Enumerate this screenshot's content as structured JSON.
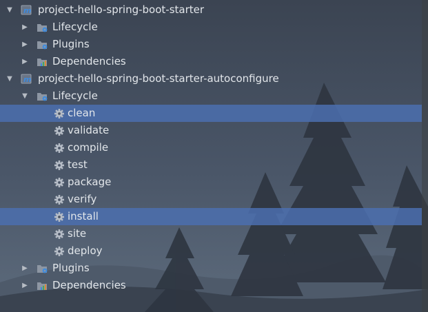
{
  "tree": {
    "rows": [
      {
        "label": "project-hello-spring-boot-starter",
        "icon": "maven-module-icon",
        "expander": "expanded"
      },
      {
        "label": "Lifecycle",
        "icon": "folder-gear-icon",
        "expander": "collapsed"
      },
      {
        "label": "Plugins",
        "icon": "folder-gear-icon",
        "expander": "collapsed"
      },
      {
        "label": "Dependencies",
        "icon": "dependencies-icon",
        "expander": "collapsed"
      },
      {
        "label": "project-hello-spring-boot-starter-autoconfigure",
        "icon": "maven-module-icon",
        "expander": "expanded"
      },
      {
        "label": "Lifecycle",
        "icon": "folder-gear-icon",
        "expander": "expanded"
      },
      {
        "label": "clean",
        "icon": "gear-icon",
        "selected": true
      },
      {
        "label": "validate",
        "icon": "gear-icon"
      },
      {
        "label": "compile",
        "icon": "gear-icon"
      },
      {
        "label": "test",
        "icon": "gear-icon"
      },
      {
        "label": "package",
        "icon": "gear-icon"
      },
      {
        "label": "verify",
        "icon": "gear-icon"
      },
      {
        "label": "install",
        "icon": "gear-icon",
        "selected": true
      },
      {
        "label": "site",
        "icon": "gear-icon"
      },
      {
        "label": "deploy",
        "icon": "gear-icon"
      },
      {
        "label": "Plugins",
        "icon": "folder-gear-icon",
        "expander": "collapsed"
      },
      {
        "label": "Dependencies",
        "icon": "dependencies-icon",
        "expander": "collapsed"
      }
    ]
  },
  "colors": {
    "selection": "#4b6eaf",
    "text": "#e2e6ea",
    "background": "#3c4655"
  }
}
